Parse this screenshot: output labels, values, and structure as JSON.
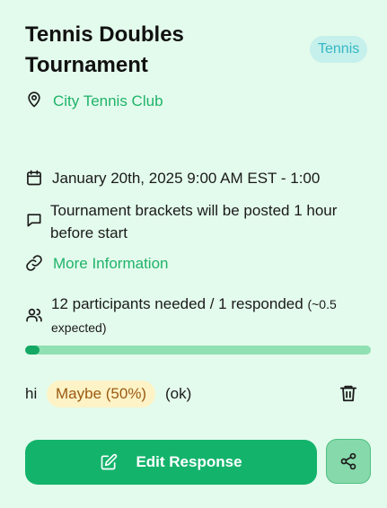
{
  "event": {
    "title": "Tennis Doubles Tournament",
    "sport": "Tennis",
    "location": "City Tennis Club",
    "datetime": "January 20th, 2025 9:00 AM EST - 1:00",
    "notes": "Tournament brackets will be posted 1 hour before start",
    "more_info_label": "More Information"
  },
  "participants": {
    "summary": "12 participants needed / 1 responded",
    "expected": "(~0.5 expected)",
    "progress_fraction": 0.042
  },
  "response": {
    "name": "hi",
    "status": "Maybe (50%)",
    "note": "(ok)"
  },
  "actions": {
    "edit_label": "Edit Response"
  },
  "icons": {
    "location": "map-pin-icon",
    "date": "calendar-icon",
    "notes": "message-icon",
    "link": "link-icon",
    "participants": "users-icon",
    "delete": "trash-icon",
    "edit": "edit-icon",
    "share": "share-icon"
  },
  "colors": {
    "background": "#e3fbec",
    "accent": "#14b36c",
    "link": "#1fb36a",
    "sport_badge_bg": "#c5f0ec",
    "sport_badge_text": "#36b7c4",
    "maybe_bg": "#fdf3c6",
    "maybe_text": "#9a5a12",
    "progress_track": "#8fe0b2",
    "progress_fill": "#14a864"
  }
}
